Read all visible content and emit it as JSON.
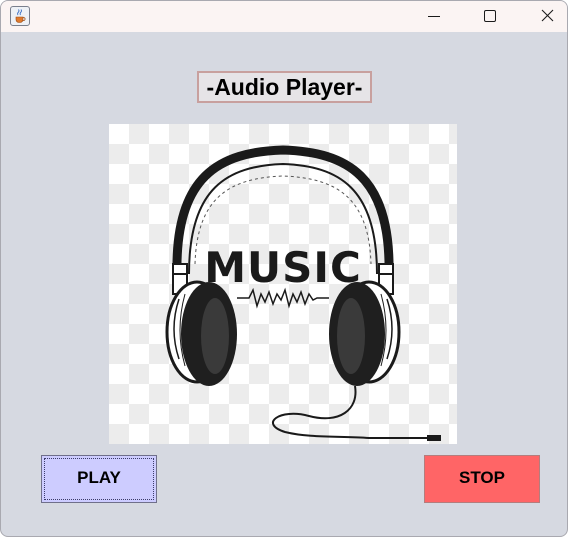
{
  "window": {
    "app_icon": "java-cup-icon",
    "controls": {
      "minimize": "minimize-icon",
      "maximize": "maximize-icon",
      "close": "close-icon"
    }
  },
  "main": {
    "title": "-Audio Player-",
    "image": {
      "icon": "headphones-music-image",
      "text": "MUSIC"
    },
    "play_button": "PLAY",
    "stop_button": "STOP"
  },
  "colors": {
    "window_bg": "#d6d9e1",
    "titlebar_bg": "#fbf4f3",
    "play_bg": "#cdccff",
    "stop_bg": "#ff6566"
  }
}
